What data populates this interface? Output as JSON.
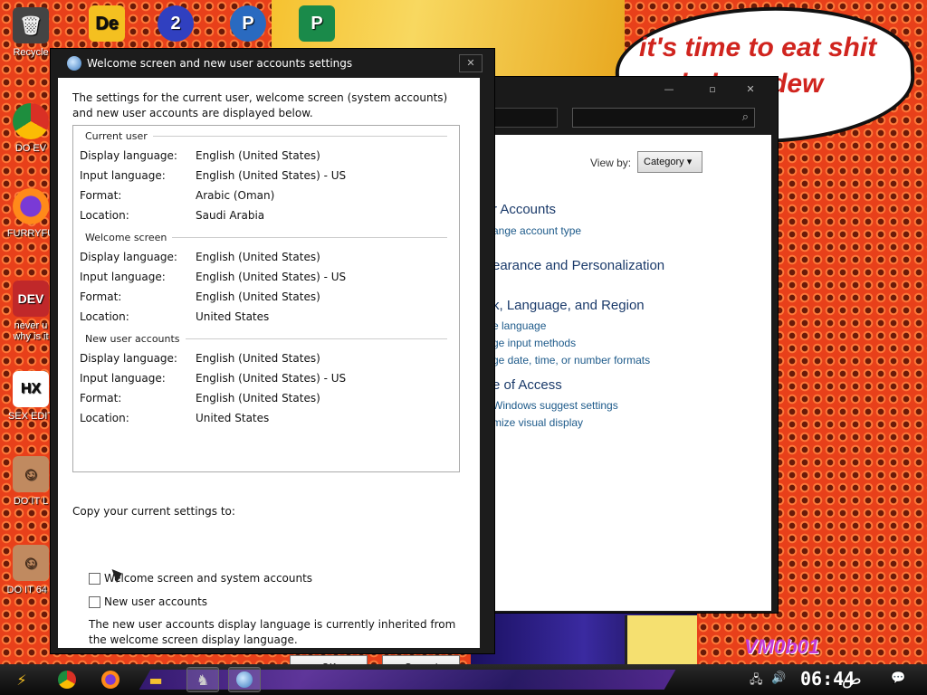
{
  "desktop": {
    "speech_bubble": "it's time to eat shit and chew dew",
    "watermark": "VM0b01",
    "icons": [
      {
        "label": "Recycle",
        "glyph": "🗑",
        "color": "#444444"
      },
      {
        "label": "DO EV",
        "glyph": "●",
        "color": "#3a7ad6"
      },
      {
        "label": "FURRYFU",
        "glyph": "🦊",
        "color": "#e06a1a"
      },
      {
        "label": "never u why is it",
        "glyph": "DEV",
        "color": "#c0282a"
      },
      {
        "label": "SEX EDIT",
        "glyph": "HX",
        "color": "#ffffff"
      },
      {
        "label": "DO IT L",
        "glyph": "☺",
        "color": "#c08a60"
      },
      {
        "label": "DO IT 64 c",
        "glyph": "☺",
        "color": "#c08a60"
      }
    ],
    "top_icons": [
      {
        "label": "De",
        "color": "#f4c020"
      },
      {
        "label": "2",
        "color": "#3040c0"
      },
      {
        "label": "P",
        "color": "#2a6ac0"
      },
      {
        "label": "P",
        "color": "#1a8a4a"
      }
    ]
  },
  "control_panel": {
    "view_by_label": "View by:",
    "view_by_value": "Category",
    "categories": [
      {
        "heading": "r Accounts",
        "links": [
          "ange account type"
        ]
      },
      {
        "heading": "earance and Personalization",
        "links": []
      },
      {
        "heading": "k, Language, and Region",
        "links": [
          "e language",
          "ge input methods",
          "ge date, time, or number formats"
        ]
      },
      {
        "heading": "e of Access",
        "links": [
          "Windows suggest settings",
          "mize visual display"
        ]
      }
    ],
    "search_icon": "search-icon"
  },
  "dialog": {
    "title": "Welcome screen and new user accounts settings",
    "intro": "The settings for the current user, welcome screen (system accounts) and new user accounts are displayed below.",
    "groups": [
      {
        "name": "Current user",
        "rows": [
          {
            "key": "Display language:",
            "value": "English (United States)"
          },
          {
            "key": "Input language:",
            "value": "English (United States) - US"
          },
          {
            "key": "Format:",
            "value": "Arabic (Oman)"
          },
          {
            "key": "Location:",
            "value": "Saudi Arabia"
          }
        ]
      },
      {
        "name": "Welcome screen",
        "rows": [
          {
            "key": "Display language:",
            "value": "English (United States)"
          },
          {
            "key": "Input language:",
            "value": "English (United States) - US"
          },
          {
            "key": "Format:",
            "value": "English (United States)"
          },
          {
            "key": "Location:",
            "value": "United States"
          }
        ]
      },
      {
        "name": "New user accounts",
        "rows": [
          {
            "key": "Display language:",
            "value": "English (United States)"
          },
          {
            "key": "Input language:",
            "value": "English (United States) - US"
          },
          {
            "key": "Format:",
            "value": "English (United States)"
          },
          {
            "key": "Location:",
            "value": "United States"
          }
        ]
      }
    ],
    "copy_label": "Copy your current settings to:",
    "checkbox_welcome": "Welcome screen and system accounts",
    "checkbox_new_users": "New user accounts",
    "note": "The new user accounts display language is currently inherited from the welcome screen display language.",
    "ok_label": "OK",
    "cancel_label": "Cancel",
    "close_glyph": "✕"
  },
  "taskbar": {
    "clock": "06:44",
    "ampm": "ص",
    "tray_icons": [
      "network-icon",
      "volume-icon",
      "notification-icon"
    ]
  }
}
